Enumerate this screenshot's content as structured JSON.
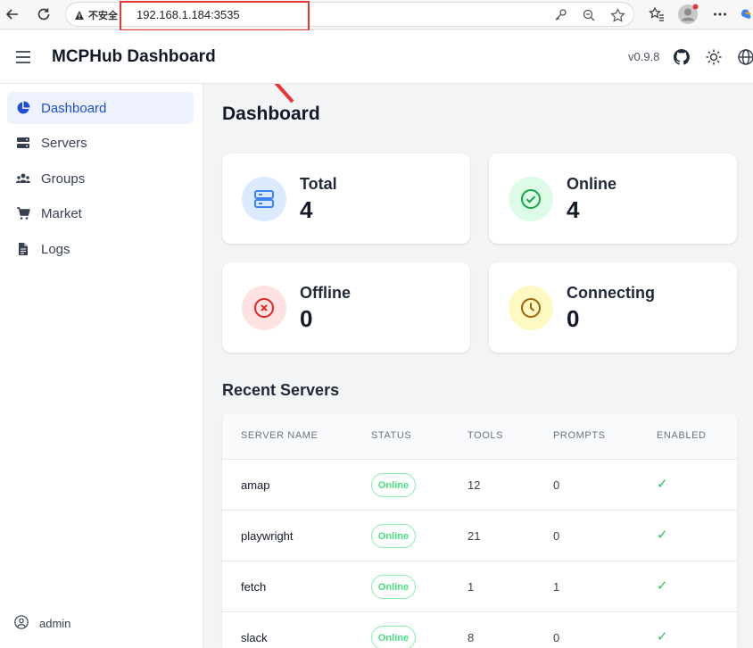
{
  "browser": {
    "security_label": "不安全",
    "url": "192.168.1.184:3535"
  },
  "header": {
    "title": "MCPHub Dashboard",
    "version": "v0.9.8"
  },
  "sidebar": {
    "items": [
      {
        "label": "Dashboard",
        "icon": "pie-chart-icon",
        "active": true
      },
      {
        "label": "Servers",
        "icon": "server-icon"
      },
      {
        "label": "Groups",
        "icon": "users-icon"
      },
      {
        "label": "Market",
        "icon": "cart-icon"
      },
      {
        "label": "Logs",
        "icon": "document-icon"
      }
    ],
    "user": "admin"
  },
  "main": {
    "title": "Dashboard",
    "stats": [
      {
        "label": "Total",
        "value": "4",
        "color": "#3b82f6",
        "bg": "#dbeafe"
      },
      {
        "label": "Online",
        "value": "4",
        "color": "#16a34a",
        "bg": "#dcfce7"
      },
      {
        "label": "Offline",
        "value": "0",
        "color": "#dc2626",
        "bg": "#fee2e2"
      },
      {
        "label": "Connecting",
        "value": "0",
        "color": "#a16207",
        "bg": "#fef9c3"
      }
    ],
    "recent_title": "Recent Servers",
    "columns": [
      "SERVER NAME",
      "STATUS",
      "TOOLS",
      "PROMPTS",
      "ENABLED"
    ],
    "rows": [
      {
        "name": "amap",
        "status": "Online",
        "tools": "12",
        "prompts": "0",
        "enabled": "✓"
      },
      {
        "name": "playwright",
        "status": "Online",
        "tools": "21",
        "prompts": "0",
        "enabled": "✓"
      },
      {
        "name": "fetch",
        "status": "Online",
        "tools": "1",
        "prompts": "1",
        "enabled": "✓"
      },
      {
        "name": "slack",
        "status": "Online",
        "tools": "8",
        "prompts": "0",
        "enabled": "✓"
      }
    ]
  }
}
